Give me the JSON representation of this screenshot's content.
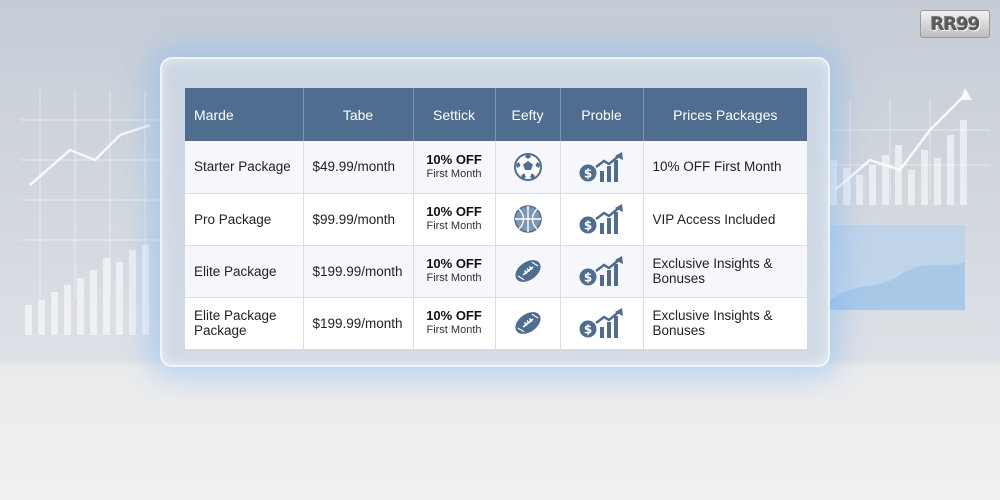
{
  "logo": {
    "text": "RR99"
  },
  "table": {
    "headers": [
      "Marde",
      "Tabe",
      "Settick",
      "Eefty",
      "Proble",
      "Prices Packages"
    ],
    "rows": [
      {
        "name": "Starter Package",
        "price": "$49.99/month",
        "offer_main": "10% OFF",
        "offer_sub": "First Month",
        "sport_icon": "soccer-ball-icon",
        "growth_icon": "dollar-growth-chart-icon",
        "benefit": "10% OFF First Month"
      },
      {
        "name": "Pro Package",
        "price": "$99.99/month",
        "offer_main": "10% OFF",
        "offer_sub": "First Month",
        "sport_icon": "basketball-icon",
        "growth_icon": "dollar-growth-chart-icon",
        "benefit": "VIP Access Included"
      },
      {
        "name": "Elite Package",
        "price": "$199.99/month",
        "offer_main": "10% OFF",
        "offer_sub": "First Month",
        "sport_icon": "american-football-icon",
        "growth_icon": "dollar-growth-chart-icon",
        "benefit": "Exclusive Insights & Bonuses"
      },
      {
        "name": "Elite Package Package",
        "price": "$199.99/month",
        "offer_main": "10% OFF",
        "offer_sub": "First Month",
        "sport_icon": "american-football-icon",
        "growth_icon": "dollar-growth-chart-icon",
        "benefit": "Exclusive Insights & Bonuses"
      }
    ]
  },
  "colors": {
    "header_bg": "#4f6d8e",
    "icon": "#4f6d8e",
    "glow": "#78b4f5"
  }
}
